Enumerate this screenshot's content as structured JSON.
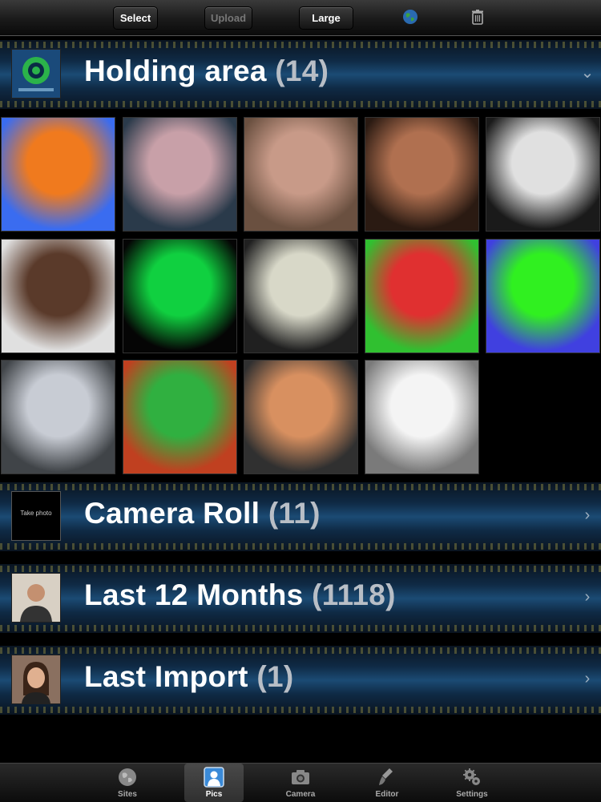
{
  "toolbar": {
    "select_label": "Select",
    "upload_label": "Upload",
    "size_label": "Large"
  },
  "albums": [
    {
      "title": "Holding area",
      "count": "(14)"
    },
    {
      "title": "Camera Roll",
      "count": "(11)"
    },
    {
      "title": "Last 12 Months",
      "count": "(1118)"
    },
    {
      "title": "Last Import",
      "count": "(1)"
    }
  ],
  "camera_roll_thumb_text": "Take photo",
  "tabs": [
    {
      "label": "Sites",
      "icon": "globe-icon"
    },
    {
      "label": "Pics",
      "icon": "person-icon"
    },
    {
      "label": "Camera",
      "icon": "camera-icon"
    },
    {
      "label": "Editor",
      "icon": "brush-icon"
    },
    {
      "label": "Settings",
      "icon": "gears-icon"
    }
  ],
  "active_tab": "Pics",
  "photo_colors": [
    [
      "#f07a1e",
      "#3a6cf0"
    ],
    [
      "#c8a0a8",
      "#2a3a4a"
    ],
    [
      "#c89a88",
      "#6a5040"
    ],
    [
      "#b07050",
      "#2a1a12"
    ],
    [
      "#e0e0e0",
      "#1a1a1a"
    ],
    [
      "#5a3a2a",
      "#e0e0e0"
    ],
    [
      "#10d040",
      "#050505"
    ],
    [
      "#d8d8c8",
      "#202020"
    ],
    [
      "#e03030",
      "#30c030"
    ],
    [
      "#30f020",
      "#4040e0"
    ],
    [
      "#c8ccd4",
      "#404448"
    ],
    [
      "#30b040",
      "#c04020"
    ],
    [
      "#d89060",
      "#303030"
    ],
    [
      "#f4f4f4",
      "#7a7a7a"
    ]
  ]
}
